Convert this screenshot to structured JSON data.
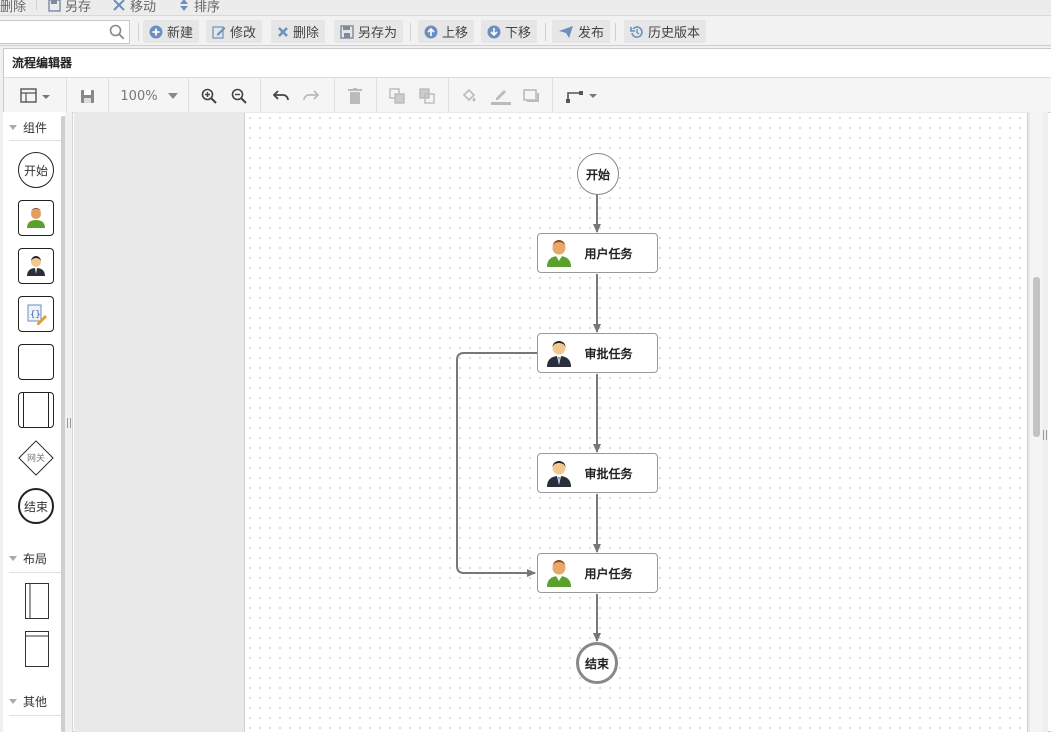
{
  "app_toolbar_top": {
    "buttons": [
      {
        "label": "删除",
        "icon": "delete-icon"
      },
      {
        "label": "另存",
        "icon": "save-icon"
      },
      {
        "label": "移动",
        "icon": "move-icon"
      },
      {
        "label": "排序",
        "icon": "sort-icon"
      }
    ]
  },
  "app_toolbar": {
    "search_placeholder": "",
    "buttons": [
      {
        "label": "新建",
        "icon": "plus-circle-icon"
      },
      {
        "label": "修改",
        "icon": "edit-icon"
      },
      {
        "label": "删除",
        "icon": "close-icon"
      },
      {
        "label": "另存为",
        "icon": "save-as-icon"
      },
      {
        "label": "上移",
        "icon": "arrow-up-circle-icon"
      },
      {
        "label": "下移",
        "icon": "arrow-down-circle-icon"
      },
      {
        "label": "发布",
        "icon": "send-icon"
      },
      {
        "label": "历史版本",
        "icon": "history-icon"
      }
    ]
  },
  "editor": {
    "title": "流程编辑器",
    "zoom": "100%"
  },
  "palette": {
    "sections": {
      "components": "组件",
      "layout": "布局",
      "other": "其他"
    },
    "start_label": "开始",
    "gateway_label": "网关",
    "end_label": "结束"
  },
  "flow": {
    "start": "开始",
    "task1": "用户任务",
    "task2": "审批任务",
    "task3": "审批任务",
    "task4": "用户任务",
    "end": "结束"
  },
  "colors": {
    "edge": "#777777",
    "accent": "#6a8fc0"
  }
}
